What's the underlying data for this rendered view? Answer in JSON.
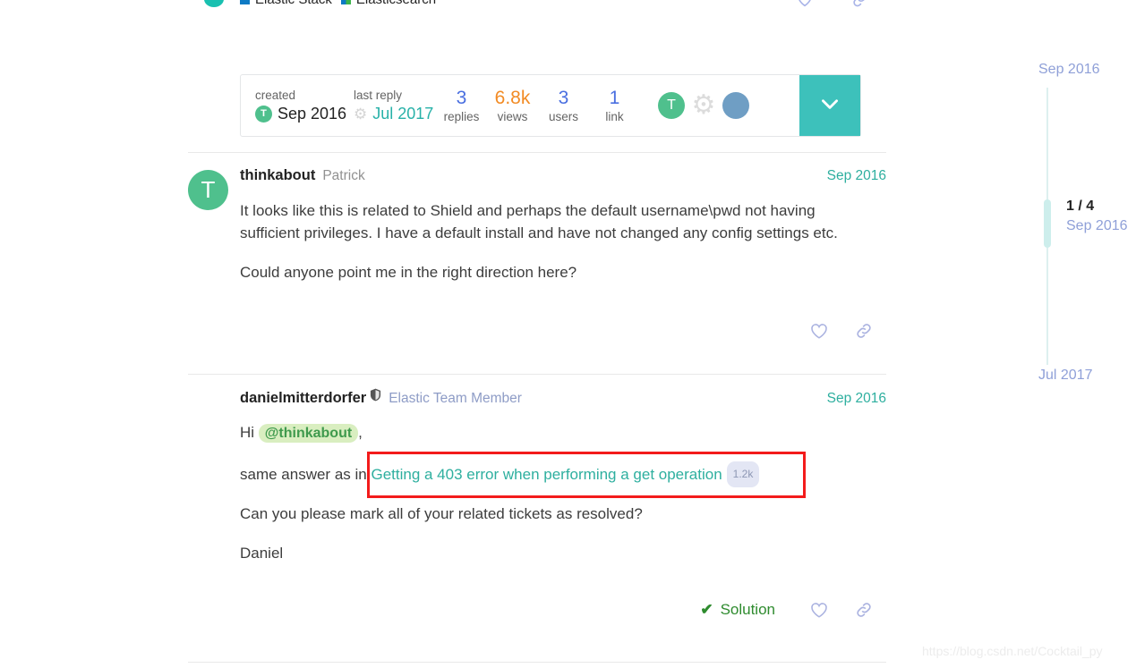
{
  "breadcrumb": {
    "logo_icon": "elastic-logo-icon",
    "items": [
      {
        "label": "Elastic Stack",
        "swatch_icon": "blue-square-icon"
      },
      {
        "label": "Elasticsearch",
        "swatch_icon": "blue-green-square-icon"
      }
    ]
  },
  "topic_map": {
    "created_label": "created",
    "created_value": "Sep 2016",
    "created_avatar_initial": "T",
    "last_reply_label": "last reply",
    "last_reply_value": "Jul 2017",
    "last_reply_icon": "gear-icon",
    "stats": [
      {
        "value": "3",
        "label": "replies",
        "color": "#4a6fe0"
      },
      {
        "value": "6.8k",
        "label": "views",
        "color": "#f28b24"
      },
      {
        "value": "3",
        "label": "users",
        "color": "#4a6fe0"
      },
      {
        "value": "1",
        "label": "link",
        "color": "#4a6fe0"
      }
    ],
    "participants": [
      {
        "type": "initial",
        "initial": "T",
        "name": "thinkabout-avatar"
      },
      {
        "type": "gear",
        "initial": "",
        "name": "gear-avatar"
      },
      {
        "type": "photo",
        "initial": "",
        "name": "danielmitterdorfer-avatar"
      }
    ],
    "expand_icon": "chevron-down-icon"
  },
  "posts": [
    {
      "avatar_type": "initial",
      "avatar_initial": "T",
      "username": "thinkabout",
      "subtitle": "Patrick",
      "has_shield": false,
      "date": "Sep 2016",
      "paragraphs": [
        "It looks like this is related to Shield and perhaps the default username\\pwd not having sufficient privileges. I have a default install and have not changed any config settings etc.",
        "Could anyone point me in the right direction here?"
      ],
      "actions": {
        "like_icon": "heart-icon",
        "share_icon": "link-icon"
      }
    },
    {
      "avatar_type": "photo",
      "avatar_initial": "",
      "username": "danielmitterdorfer",
      "subtitle": "Elastic Team Member",
      "has_shield": true,
      "shield_icon": "shield-icon",
      "date": "Sep 2016",
      "greeting_prefix": "Hi",
      "mention": "@thinkabout",
      "greeting_suffix": ",",
      "link_prefix": "same answer as in",
      "link_text": "Getting a 403 error when performing a get operation",
      "link_badge": "1.2k",
      "paragraphs": [
        "Can you please mark all of your related tickets as resolved?",
        "Daniel"
      ],
      "solution_label": "Solution",
      "solution_icon": "check-icon",
      "actions": {
        "like_icon": "heart-icon",
        "share_icon": "link-icon"
      }
    }
  ],
  "timeline": {
    "top_date": "Sep 2016",
    "bottom_date": "Jul 2017",
    "current_position": "1 / 4",
    "current_date": "Sep 2016"
  },
  "clipped_top_icons": [
    {
      "name": "heart-icon"
    },
    {
      "name": "link-icon"
    }
  ],
  "watermark": "https://blog.csdn.net/Cocktail_py",
  "colors": {
    "teal_accent": "#2eaf9f",
    "expand_button": "#3dc1bb",
    "link_blue": "#4a6fe0",
    "views_orange": "#f28b24",
    "solution_green": "#2e8b2e",
    "annotation_red": "#f31b1b",
    "mention_bg": "#d9eec0"
  }
}
